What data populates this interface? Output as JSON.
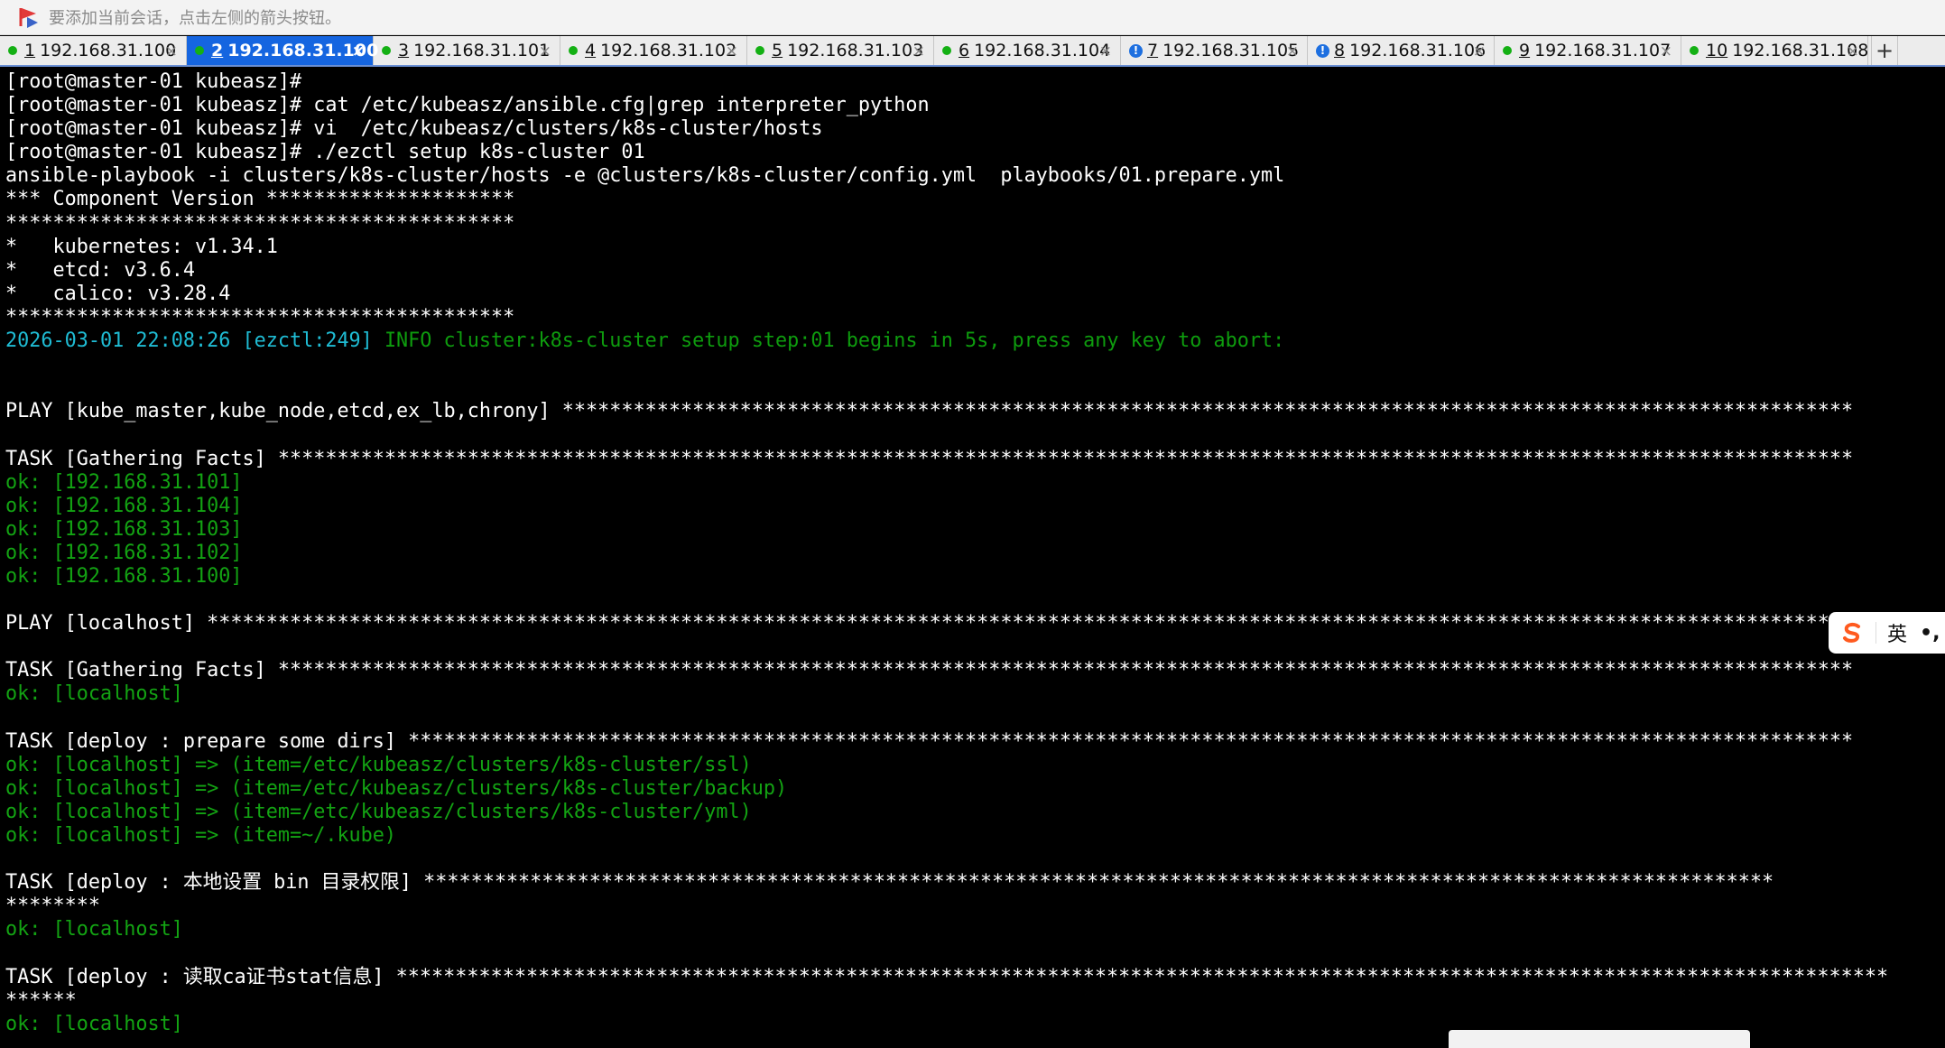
{
  "top_hint": {
    "text": "要添加当前会话，点击左侧的箭头按钮。"
  },
  "tabs": [
    {
      "num": "1",
      "host": "192.168.31.100",
      "status": "green",
      "active": false
    },
    {
      "num": "2",
      "host": "192.168.31.100",
      "status": "green",
      "active": true
    },
    {
      "num": "3",
      "host": "192.168.31.101",
      "status": "green",
      "active": false
    },
    {
      "num": "4",
      "host": "192.168.31.102",
      "status": "green",
      "active": false
    },
    {
      "num": "5",
      "host": "192.168.31.103",
      "status": "green",
      "active": false
    },
    {
      "num": "6",
      "host": "192.168.31.104",
      "status": "green",
      "active": false
    },
    {
      "num": "7",
      "host": "192.168.31.105",
      "status": "info",
      "active": false
    },
    {
      "num": "8",
      "host": "192.168.31.106",
      "status": "info",
      "active": false
    },
    {
      "num": "9",
      "host": "192.168.31.107",
      "status": "green",
      "active": false
    },
    {
      "num": "10",
      "host": "192.168.31.108",
      "status": "green",
      "active": false
    }
  ],
  "tab_close_glyph": "×",
  "tab_add_glyph": "+",
  "terminal": {
    "lines": [
      {
        "text": "[root@master-01 kubeasz]#"
      },
      {
        "text": "[root@master-01 kubeasz]# cat /etc/kubeasz/ansible.cfg|grep interpreter_python"
      },
      {
        "text": "[root@master-01 kubeasz]# vi  /etc/kubeasz/clusters/k8s-cluster/hosts"
      },
      {
        "text": "[root@master-01 kubeasz]# ./ezctl setup k8s-cluster 01"
      },
      {
        "text": "ansible-playbook -i clusters/k8s-cluster/hosts -e @clusters/k8s-cluster/config.yml  playbooks/01.prepare.yml"
      },
      {
        "text": "*** Component Version *********************"
      },
      {
        "text": "*******************************************"
      },
      {
        "text": "*   kubernetes: v1.34.1"
      },
      {
        "text": "*   etcd: v3.6.4"
      },
      {
        "text": "*   calico: v3.28.4"
      },
      {
        "text": "*******************************************"
      },
      {
        "text": "2026-03-01 22:08:26 [ezctl:249] ",
        "color": "cyan",
        "rest": "INFO cluster:k8s-cluster setup step:01 begins in 5s, press any key to abort:",
        "rest_color": "dimgreen"
      },
      {
        "text": ""
      },
      {
        "text": ""
      },
      {
        "text": "PLAY [kube_master,kube_node,etcd,ex_lb,chrony] *************************************************************************************************************"
      },
      {
        "text": ""
      },
      {
        "text": "TASK [Gathering Facts] *************************************************************************************************************************************"
      },
      {
        "text": "ok: [192.168.31.101]",
        "color": "green"
      },
      {
        "text": "ok: [192.168.31.104]",
        "color": "green"
      },
      {
        "text": "ok: [192.168.31.103]",
        "color": "green"
      },
      {
        "text": "ok: [192.168.31.102]",
        "color": "green"
      },
      {
        "text": "ok: [192.168.31.100]",
        "color": "green"
      },
      {
        "text": ""
      },
      {
        "text": "PLAY [localhost] *******************************************************************************************************************************************"
      },
      {
        "text": ""
      },
      {
        "text": "TASK [Gathering Facts] *************************************************************************************************************************************"
      },
      {
        "text": "ok: [localhost]",
        "color": "green"
      },
      {
        "text": ""
      },
      {
        "text": "TASK [deploy : prepare some dirs] **************************************************************************************************************************"
      },
      {
        "text": "ok: [localhost] => (item=/etc/kubeasz/clusters/k8s-cluster/ssl)",
        "color": "green"
      },
      {
        "text": "ok: [localhost] => (item=/etc/kubeasz/clusters/k8s-cluster/backup)",
        "color": "green"
      },
      {
        "text": "ok: [localhost] => (item=/etc/kubeasz/clusters/k8s-cluster/yml)",
        "color": "green"
      },
      {
        "text": "ok: [localhost] => (item=~/.kube)",
        "color": "green"
      },
      {
        "text": ""
      },
      {
        "text": "TASK [deploy : 本地设置 bin 目录权限] ******************************************************************************************************************"
      },
      {
        "text": "********"
      },
      {
        "text": "ok: [localhost]",
        "color": "green"
      },
      {
        "text": ""
      },
      {
        "text": "TASK [deploy : 读取ca证书stat信息] ******************************************************************************************************************************"
      },
      {
        "text": "******"
      },
      {
        "text": "ok: [localhost]",
        "color": "green"
      }
    ]
  },
  "ime": {
    "logo_icon": "sogou-s-icon",
    "lang": "英",
    "extra": "•,"
  },
  "colors": {
    "tab_active": "#1565e0",
    "status_green": "#14b014",
    "status_info": "#1d6fe0",
    "cyan": "#1fbcd4",
    "ok_green": "#13a313"
  }
}
